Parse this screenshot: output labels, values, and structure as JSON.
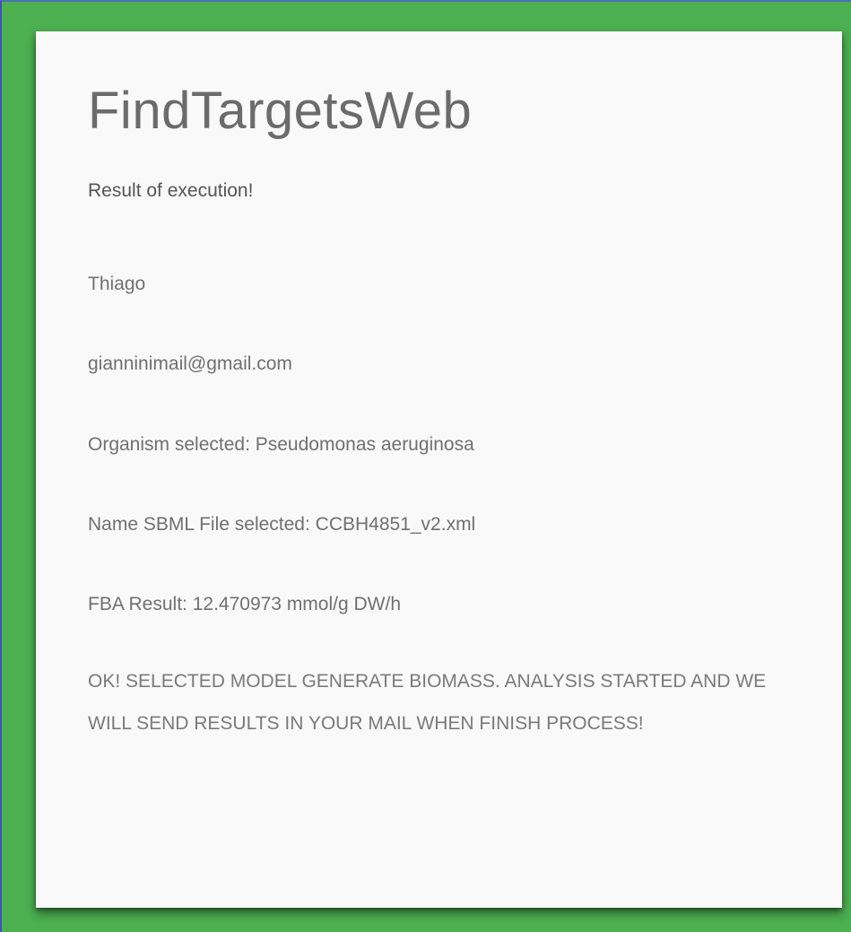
{
  "app": {
    "title": "FindTargetsWeb"
  },
  "result": {
    "heading": "Result of execution!",
    "name": "Thiago",
    "email": "gianninimail@gmail.com",
    "organism_line": "Organism selected: Pseudomonas aeruginosa",
    "sbml_line": "Name SBML File selected: CCBH4851_v2.xml",
    "fba_line": "FBA Result: 12.470973 mmol/g DW/h",
    "message": "OK! SELECTED MODEL GENERATE BIOMASS. ANALYSIS STARTED AND WE WILL SEND RESULTS IN YOUR MAIL WHEN FINISH PROCESS!"
  },
  "colors": {
    "frame": "#4caf50",
    "card": "#f9f9f9",
    "title_text": "#6b6b6b",
    "body_text": "#707070"
  }
}
